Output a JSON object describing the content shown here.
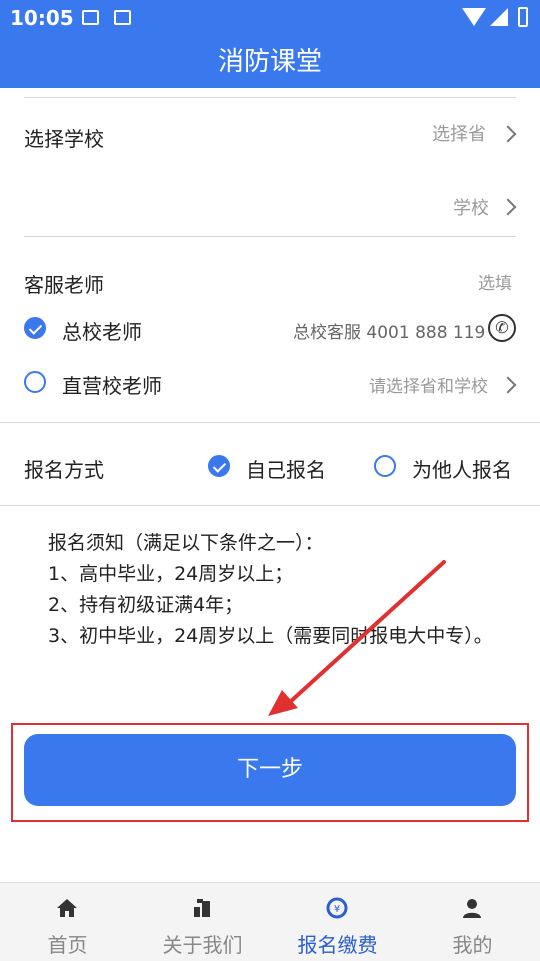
{
  "status_bar": {
    "time": "10:05"
  },
  "header": {
    "title": "消防课堂"
  },
  "school": {
    "label": "选择学校",
    "province_hint": "选择省",
    "school_hint": "学校"
  },
  "service": {
    "label": "客服老师",
    "optional_hint": "选填",
    "options": [
      {
        "label": "总校老师",
        "detail": "总校客服 4001 888 119",
        "selected": true
      },
      {
        "label": "直营校老师",
        "detail": "请选择省和学校",
        "selected": false
      }
    ]
  },
  "registration": {
    "label": "报名方式",
    "options": [
      {
        "label": "自己报名",
        "selected": true
      },
      {
        "label": "为他人报名",
        "selected": false
      }
    ]
  },
  "notice": {
    "lines": [
      "报名须知（满足以下条件之一）：",
      "1、高中毕业，24周岁以上；",
      "2、持有初级证满4年；",
      "3、初中毕业，24周岁以上（需要同时报电大中专）。"
    ]
  },
  "next_button": {
    "label": "下一步"
  },
  "tabbar": {
    "tabs": [
      {
        "label": "首页",
        "icon": "home-icon",
        "active": false
      },
      {
        "label": "关于我们",
        "icon": "about-icon",
        "active": false
      },
      {
        "label": "报名缴费",
        "icon": "payment-icon",
        "active": true
      },
      {
        "label": "我的",
        "icon": "user-icon",
        "active": false
      }
    ]
  },
  "colors": {
    "primary": "#3a78ee",
    "annotation": "#e03030"
  }
}
